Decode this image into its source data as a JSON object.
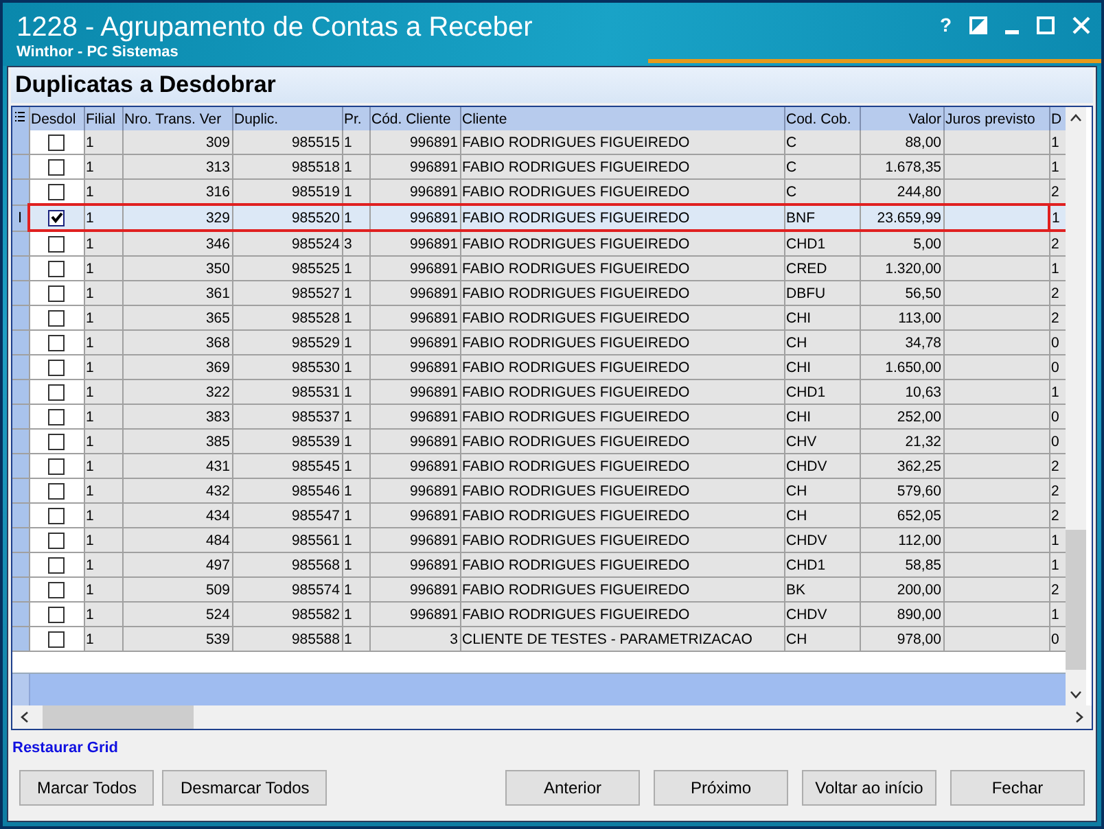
{
  "window": {
    "title": "1228 - Agrupamento de Contas a Receber",
    "subtitle": "Winthor - PC Sistemas",
    "controls": [
      {
        "kind": "help",
        "label": "?"
      },
      {
        "kind": "restore"
      },
      {
        "kind": "minimize"
      },
      {
        "kind": "maximize"
      },
      {
        "kind": "close"
      }
    ]
  },
  "panel": {
    "title": "Duplicatas a Desdobrar"
  },
  "table": {
    "checkbox_column": "Desdol",
    "columns": [
      "Filial",
      "Nro. Trans. Ver",
      "Duplic.",
      "Pr.",
      "Cód. Cliente",
      "Cliente",
      "Cod. Cob.",
      "Valor",
      "Juros previsto",
      "D"
    ],
    "rows": [
      {
        "selected": false,
        "indicator": "",
        "checked": false,
        "cells": [
          "1",
          "309",
          "985515",
          "1",
          "996891",
          "FABIO RODRIGUES FIGUEIREDO",
          "C",
          "88,00",
          "",
          "1"
        ]
      },
      {
        "selected": false,
        "indicator": "",
        "checked": false,
        "cells": [
          "1",
          "313",
          "985518",
          "1",
          "996891",
          "FABIO RODRIGUES FIGUEIREDO",
          "C",
          "1.678,35",
          "",
          "1"
        ]
      },
      {
        "selected": false,
        "indicator": "",
        "checked": false,
        "cells": [
          "1",
          "316",
          "985519",
          "1",
          "996891",
          "FABIO RODRIGUES FIGUEIREDO",
          "C",
          "244,80",
          "",
          "2"
        ]
      },
      {
        "selected": true,
        "indicator": "I",
        "checked": true,
        "cells": [
          "1",
          "329",
          "985520",
          "1",
          "996891",
          "FABIO RODRIGUES FIGUEIREDO",
          "BNF",
          "23.659,99",
          "",
          "1"
        ]
      },
      {
        "selected": false,
        "indicator": "",
        "checked": false,
        "cells": [
          "1",
          "346",
          "985524",
          "3",
          "996891",
          "FABIO RODRIGUES FIGUEIREDO",
          "CHD1",
          "5,00",
          "",
          "2"
        ]
      },
      {
        "selected": false,
        "indicator": "",
        "checked": false,
        "cells": [
          "1",
          "350",
          "985525",
          "1",
          "996891",
          "FABIO RODRIGUES FIGUEIREDO",
          "CRED",
          "1.320,00",
          "",
          "1"
        ]
      },
      {
        "selected": false,
        "indicator": "",
        "checked": false,
        "cells": [
          "1",
          "361",
          "985527",
          "1",
          "996891",
          "FABIO RODRIGUES FIGUEIREDO",
          "DBFU",
          "56,50",
          "",
          "2"
        ]
      },
      {
        "selected": false,
        "indicator": "",
        "checked": false,
        "cells": [
          "1",
          "365",
          "985528",
          "1",
          "996891",
          "FABIO RODRIGUES FIGUEIREDO",
          "CHI",
          "113,00",
          "",
          "2"
        ]
      },
      {
        "selected": false,
        "indicator": "",
        "checked": false,
        "cells": [
          "1",
          "368",
          "985529",
          "1",
          "996891",
          "FABIO RODRIGUES FIGUEIREDO",
          "CH",
          "34,78",
          "",
          "0"
        ]
      },
      {
        "selected": false,
        "indicator": "",
        "checked": false,
        "cells": [
          "1",
          "369",
          "985530",
          "1",
          "996891",
          "FABIO RODRIGUES FIGUEIREDO",
          "CHI",
          "1.650,00",
          "",
          "0"
        ]
      },
      {
        "selected": false,
        "indicator": "",
        "checked": false,
        "cells": [
          "1",
          "322",
          "985531",
          "1",
          "996891",
          "FABIO RODRIGUES FIGUEIREDO",
          "CHD1",
          "10,63",
          "",
          "1"
        ]
      },
      {
        "selected": false,
        "indicator": "",
        "checked": false,
        "cells": [
          "1",
          "383",
          "985537",
          "1",
          "996891",
          "FABIO RODRIGUES FIGUEIREDO",
          "CHI",
          "252,00",
          "",
          "0"
        ]
      },
      {
        "selected": false,
        "indicator": "",
        "checked": false,
        "cells": [
          "1",
          "385",
          "985539",
          "1",
          "996891",
          "FABIO RODRIGUES FIGUEIREDO",
          "CHV",
          "21,32",
          "",
          "0"
        ]
      },
      {
        "selected": false,
        "indicator": "",
        "checked": false,
        "cells": [
          "1",
          "431",
          "985545",
          "1",
          "996891",
          "FABIO RODRIGUES FIGUEIREDO",
          "CHDV",
          "362,25",
          "",
          "2"
        ]
      },
      {
        "selected": false,
        "indicator": "",
        "checked": false,
        "cells": [
          "1",
          "432",
          "985546",
          "1",
          "996891",
          "FABIO RODRIGUES FIGUEIREDO",
          "CH",
          "579,60",
          "",
          "2"
        ]
      },
      {
        "selected": false,
        "indicator": "",
        "checked": false,
        "cells": [
          "1",
          "434",
          "985547",
          "1",
          "996891",
          "FABIO RODRIGUES FIGUEIREDO",
          "CH",
          "652,05",
          "",
          "2"
        ]
      },
      {
        "selected": false,
        "indicator": "",
        "checked": false,
        "cells": [
          "1",
          "484",
          "985561",
          "1",
          "996891",
          "FABIO RODRIGUES FIGUEIREDO",
          "CHDV",
          "112,00",
          "",
          "1"
        ]
      },
      {
        "selected": false,
        "indicator": "",
        "checked": false,
        "cells": [
          "1",
          "497",
          "985568",
          "1",
          "996891",
          "FABIO RODRIGUES FIGUEIREDO",
          "CHD1",
          "58,85",
          "",
          "1"
        ]
      },
      {
        "selected": false,
        "indicator": "",
        "checked": false,
        "cells": [
          "1",
          "509",
          "985574",
          "1",
          "996891",
          "FABIO RODRIGUES FIGUEIREDO",
          "BK",
          "200,00",
          "",
          "2"
        ]
      },
      {
        "selected": false,
        "indicator": "",
        "checked": false,
        "cells": [
          "1",
          "524",
          "985582",
          "1",
          "996891",
          "FABIO RODRIGUES FIGUEIREDO",
          "CHDV",
          "890,00",
          "",
          "1"
        ]
      },
      {
        "selected": false,
        "indicator": "",
        "checked": false,
        "cells": [
          "1",
          "539",
          "985588",
          "1",
          "3",
          "CLIENTE DE TESTES - PARAMETRIZACAO",
          "CH",
          "978,00",
          "",
          "0"
        ]
      }
    ]
  },
  "restore_link": "Restaurar Grid",
  "buttons_left": [
    "Marcar Todos",
    "Desmarcar Todos"
  ],
  "buttons_right": [
    "Anterior",
    "Próximo",
    "Voltar ao início",
    "Fechar"
  ]
}
